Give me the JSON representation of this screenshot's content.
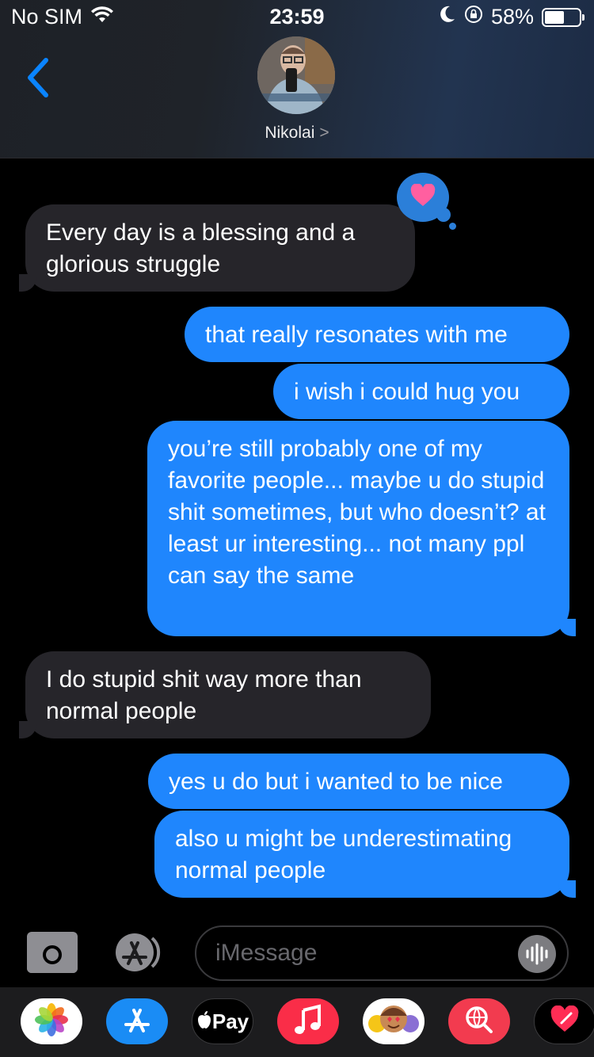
{
  "status_bar": {
    "carrier": "No SIM",
    "time": "23:59",
    "battery_percent": "58%",
    "battery_level": 0.58,
    "icons": [
      "wifi-icon",
      "moon-icon",
      "orientation-lock-icon"
    ]
  },
  "header": {
    "contact_name": "Nikolai",
    "chevron": ">"
  },
  "messages": [
    {
      "direction": "in",
      "text": "Every day is a blessing and a glorious struggle",
      "tapback": "heart"
    },
    {
      "direction": "out",
      "text": "that really resonates with me"
    },
    {
      "direction": "out",
      "text": "i wish i could hug you"
    },
    {
      "direction": "out",
      "text": "you’re still probably one of my favorite people... maybe u do stupid shit sometimes, but who doesn’t? at least ur interesting... not many ppl can say the same"
    },
    {
      "direction": "in",
      "text": "I do stupid shit way more than normal people"
    },
    {
      "direction": "out",
      "text": "yes u do but i wanted to be nice"
    },
    {
      "direction": "out",
      "text": "also u might be underestimating normal people"
    }
  ],
  "input": {
    "placeholder": "iMessage"
  },
  "app_strip": {
    "apple_pay_label": "Pay",
    "apps": [
      "photos-app",
      "app-store-app",
      "apple-pay-app",
      "music-app",
      "memoji-app",
      "web-search-app",
      "digital-touch-app"
    ]
  },
  "colors": {
    "outgoing": "#1f86fd",
    "incoming": "#26252a",
    "accent": "#0a84ff"
  }
}
